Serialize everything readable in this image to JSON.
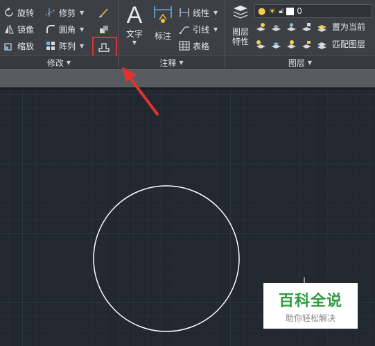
{
  "modify_panel": {
    "rotate": "旋转",
    "trim": "修剪",
    "mirror": "镜像",
    "fillet": "圆角",
    "scale": "缩放",
    "array": "阵列",
    "footer": "修改"
  },
  "annotation_panel": {
    "text": "文字",
    "dimension": "标注",
    "linear": "线性",
    "leader": "引线",
    "table": "表格",
    "footer": "注释"
  },
  "layers_panel": {
    "layer_properties": "图层\n特性",
    "layer_properties_line1": "图层",
    "layer_properties_line2": "特性",
    "current_layer": "0",
    "set_current": "置为当前",
    "match_layer": "匹配图层",
    "footer": "图层"
  },
  "watermark": {
    "title": "百科全说",
    "subtitle": "助你轻松解决"
  },
  "colors": {
    "ribbon_bg": "#3c3f45",
    "canvas_bg": "#212830",
    "highlight": "#e0332f",
    "circle": "#ffffff",
    "watermark_green": "#2f9a3f"
  }
}
